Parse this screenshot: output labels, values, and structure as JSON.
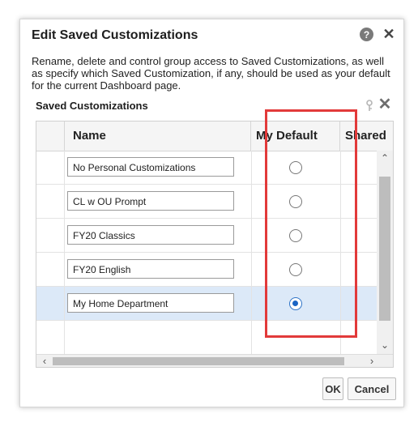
{
  "dialog": {
    "title": "Edit Saved Customizations",
    "help_icon": "help-icon",
    "close_icon": "close-icon",
    "description": "Rename, delete and control group access to Saved Customizations, as well as specify which Saved Customization, if any, should be used as your default for the current Dashboard page.",
    "section_title": "Saved Customizations",
    "section_icons": [
      "key-icon",
      "delete-icon"
    ]
  },
  "table": {
    "columns": [
      "Name",
      "My Default",
      "Shared"
    ],
    "rows": [
      {
        "name": "No Personal Customizations",
        "default": false
      },
      {
        "name": "CL w OU Prompt",
        "default": false
      },
      {
        "name": "FY20 Classics",
        "default": false
      },
      {
        "name": "FY20 English",
        "default": false
      },
      {
        "name": "My Home Department",
        "default": true
      }
    ]
  },
  "buttons": {
    "ok": "OK",
    "cancel": "Cancel"
  },
  "colors": {
    "highlight_border": "#e23a3a",
    "selected_row": "#dce9f8",
    "radio_checked": "#1a64c4"
  }
}
